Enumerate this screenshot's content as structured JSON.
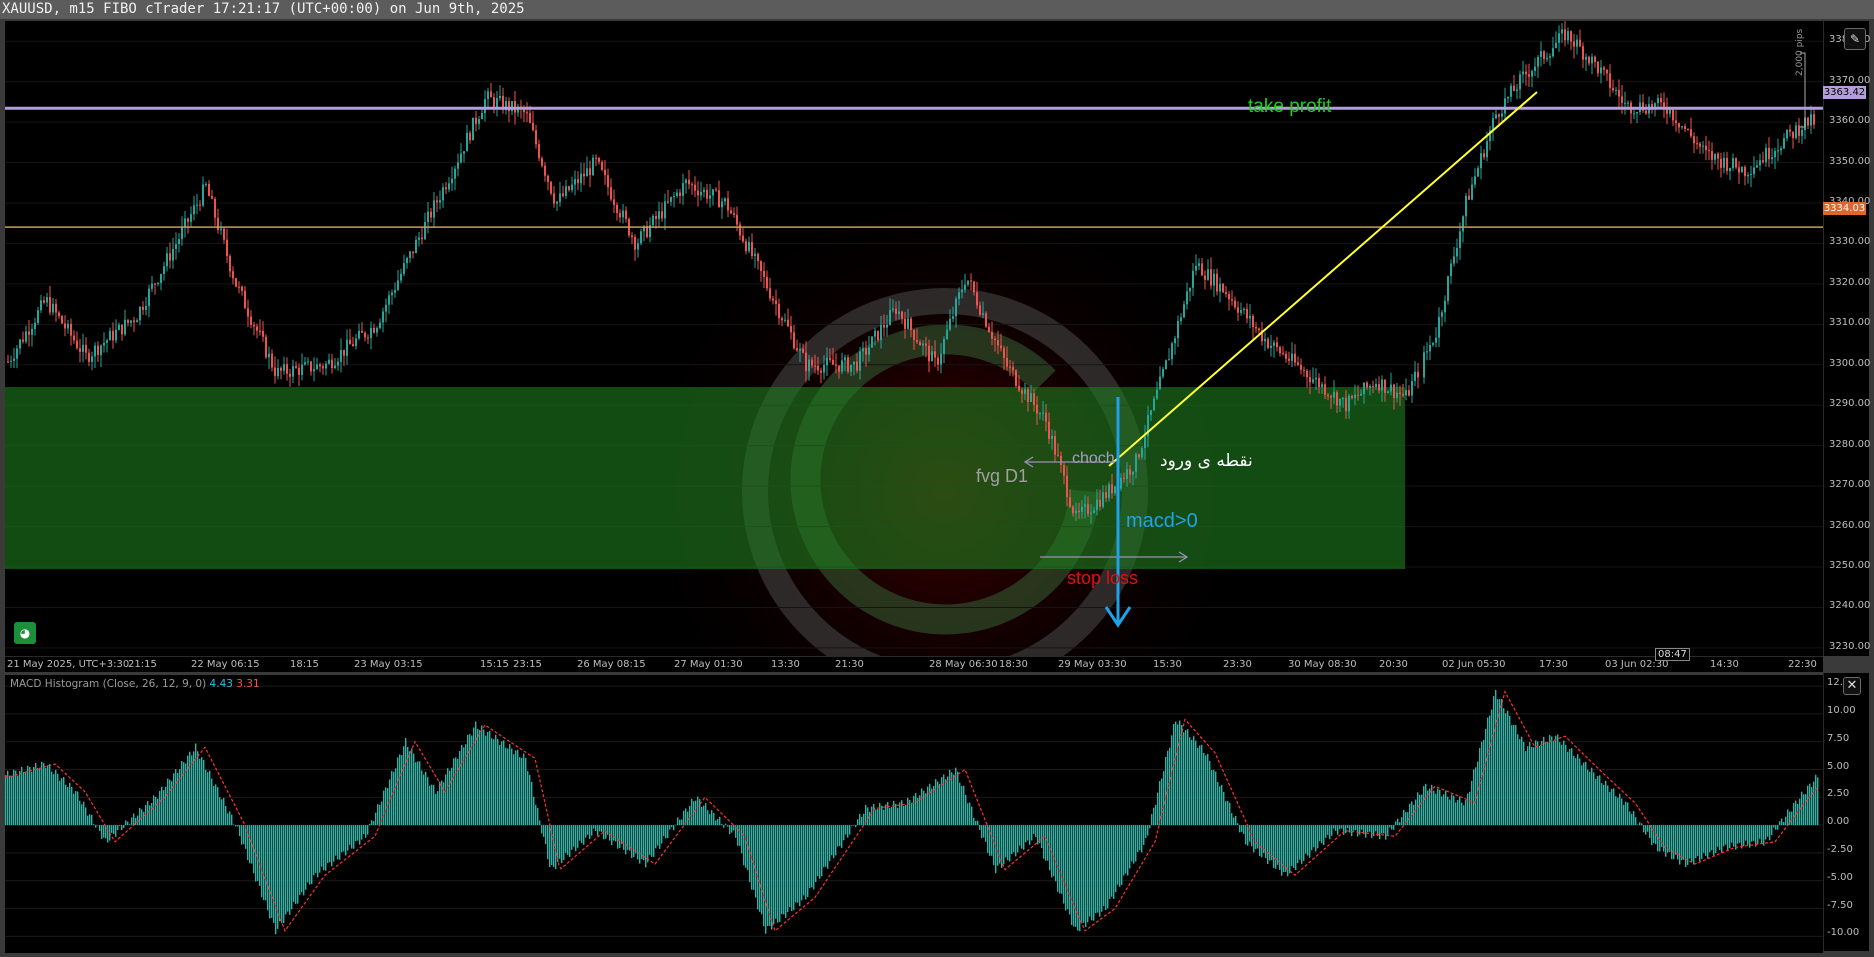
{
  "window": {
    "title": "XAUUSD, m15 FIBO cTrader 17:21:17 (UTC+00:00) on Jun 9th, 2025"
  },
  "price_axis": {
    "labels": [
      "3380.00",
      "3370.00",
      "3360.00",
      "3350.00",
      "3340.00",
      "3330.00",
      "3320.00",
      "3310.00",
      "3300.00",
      "3290.00",
      "3280.00",
      "3270.00",
      "3260.00",
      "3250.00",
      "3240.00",
      "3230.00"
    ],
    "values": [
      3380,
      3370,
      3360,
      3350,
      3340,
      3330,
      3320,
      3310,
      3300,
      3290,
      3280,
      3270,
      3260,
      3250,
      3240,
      3230
    ],
    "range": [
      3228.0,
      3385.0
    ],
    "take_profit_tag": "3363.42",
    "current_tag": "3334.03",
    "pips_label": "2,000 pips"
  },
  "time_axis": {
    "labels": [
      "21 May 2025, UTC+3:30",
      "21:15",
      "22 May 06:15",
      "18:15",
      "23 May 03:15",
      "15:15",
      "23:15",
      "26 May 08:15",
      "27 May 01:30",
      "13:30",
      "21:30",
      "28 May 06:30",
      "18:30",
      "29 May 03:30",
      "15:30",
      "23:30",
      "30 May 08:30",
      "20:30",
      "02 Jun 05:30",
      "17:30",
      "03 Jun 02:30",
      "14:30",
      "22:30"
    ],
    "countdown": "08:47"
  },
  "annotations": {
    "take_profit": "take profit",
    "choch": "choch",
    "entry_point": "نقطه ی ورود",
    "fvg": "fvg D1",
    "macd_condition": "macd>0",
    "stop_loss": "stop loss"
  },
  "levels": {
    "take_profit": 3363.42,
    "current": 3334.03,
    "zone_top": 3294.5,
    "zone_bottom": 3249.5
  },
  "indicator": {
    "name": "MACD Histogram (Close, 26, 12, 9, 0)",
    "value1": "4.43",
    "value2": "3.31",
    "axis_labels": [
      "12.50",
      "10.00",
      "7.50",
      "5.00",
      "2.50",
      "0.00",
      "-2.50",
      "-5.00",
      "-7.50",
      "-10.00"
    ],
    "axis_values": [
      12.5,
      10,
      7.5,
      5,
      2.5,
      0,
      -2.5,
      -5,
      -7.5,
      -10
    ],
    "range": [
      -11.5,
      13.5
    ]
  },
  "colors": {
    "bull": "#26a69a",
    "bear": "#ef5350",
    "take_profit_line": "#b39ddb",
    "current_line": "#c8a050",
    "zone": "#1f7a1f",
    "macd_hist": "#2bb5a8",
    "signal": "#ff3030",
    "arrow": "#1fa2e8",
    "trend_line": "#ffff33",
    "tp_text": "#22cc22",
    "sl_text": "#e01010"
  },
  "icons": {
    "chart_settings": "edit-square-icon",
    "bot": "robot-icon",
    "close_indicator": "close-icon"
  }
}
